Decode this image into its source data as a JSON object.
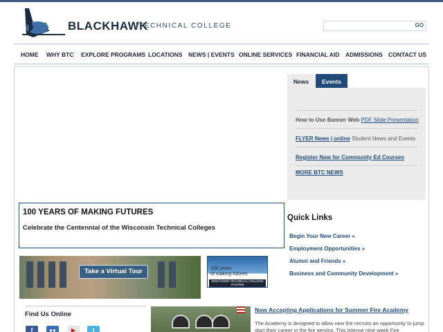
{
  "header": {
    "logo_name": "BLACKHAWK",
    "logo_tagline": "TECHNICAL COLLEGE",
    "search_placeholder": "",
    "go_label": "GO"
  },
  "nav": {
    "items": [
      "HOME",
      "WHY BTC",
      "EXPLORE PROGRAMS",
      "LOCATIONS",
      "NEWS | EVENTS",
      "ONLINE SERVICES",
      "FINANCIAL AID",
      "ADMISSIONS",
      "CONTACT US"
    ]
  },
  "news": {
    "tabs": [
      "News",
      "Events"
    ],
    "items": [
      {
        "prefix": "How to Use Banner Web",
        "link": "PDF Slide Presentation"
      },
      {
        "link": "FLYER News | online",
        "suffix": "Student News and Events"
      },
      {
        "link": "Register Now for Community Ed Courses"
      },
      {
        "link": "MORE BTC NEWS"
      }
    ]
  },
  "centennial": {
    "title": "100 YEARS OF MAKING FUTURES",
    "subtitle": "Celebrate the Centennial of the Wisconsin Technical Colleges"
  },
  "quick_links": {
    "title": "Quick Links",
    "items": [
      "Begin Your New Career »",
      "Employment Opportunities »",
      "Alumni and Friends »",
      "Business and Community Development »"
    ]
  },
  "tour": {
    "button_label": "Take a Virtual Tour"
  },
  "badge": {
    "line1": "100 years",
    "line2": "of making futures",
    "footer": "WISCONSIN TECHNICAL COLLEGE SYSTEM"
  },
  "find_us": {
    "title": "Find Us Online",
    "icons": [
      "facebook-icon",
      "flickr-icon",
      "youtube-icon",
      "twitter-icon"
    ]
  },
  "fire": {
    "title": "Now Accepting Applications for Summer Fire Academy",
    "body": "The Academy is designed to allow new fire recruits an opportunity to jump start their career in the fire service. This intense nine week Fire"
  },
  "colors": {
    "brand_navy": "#1f4a7a",
    "top_bar": "#3d5a80"
  }
}
